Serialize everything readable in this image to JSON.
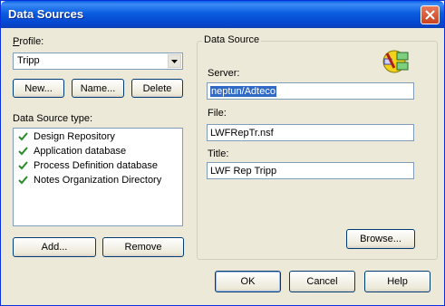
{
  "window": {
    "title": "Data Sources",
    "close_icon": "close-icon"
  },
  "profile": {
    "label": "Profile:",
    "selected": "Tripp",
    "new_label": "New...",
    "name_label": "Name...",
    "delete_label": "Delete"
  },
  "types": {
    "label": "Data Source type:",
    "items": [
      {
        "label": "Design Repository",
        "icon": "checkmark-icon"
      },
      {
        "label": "Application database",
        "icon": "checkmark-icon"
      },
      {
        "label": "Process Definition database",
        "icon": "checkmark-icon"
      },
      {
        "label": "Notes Organization Directory",
        "icon": "checkmark-icon"
      }
    ],
    "add_label": "Add...",
    "remove_label": "Remove"
  },
  "datasource": {
    "group_title": "Data Source",
    "icon": "data-source-icon",
    "server_label": "Server:",
    "server_value": "neptun/Adteco",
    "file_label": "File:",
    "file_value": "LWFRepTr.nsf",
    "title_label": "Title:",
    "title_value": "LWF Rep Tripp",
    "browse_label": "Browse..."
  },
  "footer": {
    "ok_label": "OK",
    "cancel_label": "Cancel",
    "help_label": "Help"
  }
}
